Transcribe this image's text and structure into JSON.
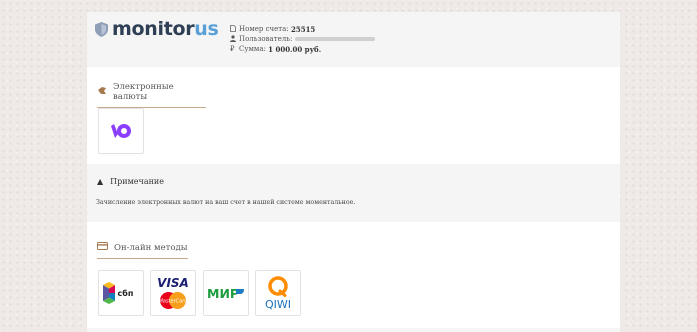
{
  "brand": {
    "logo_part1": "monitor",
    "logo_part2": "us"
  },
  "account": {
    "number_label": "Номер счета:",
    "number_value": "25515",
    "user_label": "Пользователь:",
    "amount_label": "Сумма:",
    "amount_value": "1 000.00 руб."
  },
  "sections": {
    "crypto_title": "Электронные валюты",
    "online_title": "Он-лайн методы"
  },
  "note": {
    "title": "Примечание",
    "text": "Зачисление электронных валют на ваш счет в нашей системе моментальное."
  },
  "payment_methods": {
    "yoomoney_icon": "yoomoney-logo",
    "sbp_text": "сбп",
    "visa_text": "VISA",
    "mastercard_text": "MasterCard",
    "mir_text": "МИР",
    "qiwi_text": "QIWI"
  },
  "colors": {
    "accent_underline": "#c9a98b",
    "yoomoney": "#8b3ffd",
    "visa": "#1a1f71",
    "mir": "#1f9c3e",
    "qiwi": "#ff8c00",
    "logo_dark": "#2f3f55",
    "logo_light": "#5a9fd6"
  }
}
